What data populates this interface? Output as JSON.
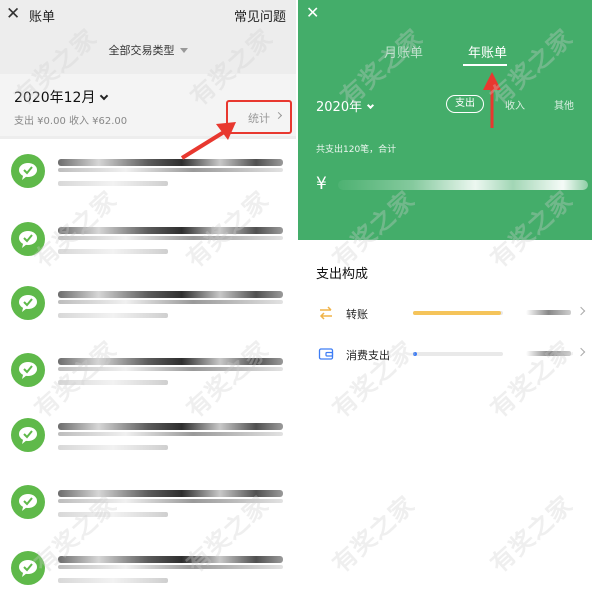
{
  "left": {
    "header": {
      "close_glyph": "✕",
      "title": "账单",
      "faq": "常见问题"
    },
    "filter": "全部交易类型",
    "month": {
      "label": "2020年12月",
      "summary": "支出 ¥0.00 收入 ¥62.00",
      "stats": "统计"
    },
    "list_item_count": 7
  },
  "right": {
    "header": {
      "close_glyph": "✕"
    },
    "tabs": {
      "month": "月账单",
      "year": "年账单"
    },
    "year": "2020年",
    "type_tabs": {
      "expense": "支出",
      "income": "收入",
      "other": "其他"
    },
    "total": "共支出120笔，合计",
    "currency": "¥",
    "section_title": "支出构成",
    "categories": [
      {
        "label": "转账",
        "icon": "transfer-icon",
        "share": 0.98,
        "color": "#f5c45a"
      },
      {
        "label": "消费支出",
        "icon": "wallet-icon",
        "share": 0.02,
        "color": "#3d7df5"
      }
    ]
  },
  "watermark": "有奖之家",
  "colors": {
    "brand_green": "#44ad6a",
    "wechat_green": "#5fb94a",
    "annotation_red": "#e8382f"
  }
}
